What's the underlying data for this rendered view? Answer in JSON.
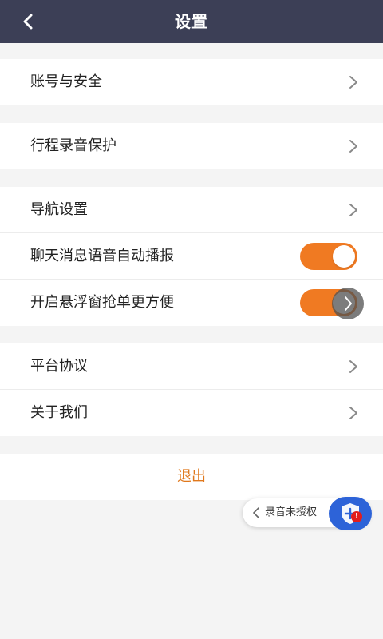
{
  "header": {
    "title": "设置"
  },
  "groups": [
    {
      "items": [
        {
          "label": "账号与安全",
          "control": "chevron"
        }
      ]
    },
    {
      "items": [
        {
          "label": "行程录音保护",
          "control": "chevron"
        }
      ]
    },
    {
      "items": [
        {
          "label": "导航设置",
          "control": "chevron"
        },
        {
          "label": "聊天消息语音自动播报",
          "control": "toggle",
          "on": true
        },
        {
          "label": "开启悬浮窗抢单更方便",
          "control": "toggle",
          "on": true
        }
      ]
    },
    {
      "items": [
        {
          "label": "平台协议",
          "control": "chevron"
        },
        {
          "label": "关于我们",
          "control": "chevron"
        }
      ]
    }
  ],
  "logout_label": "退出",
  "recording_pill": {
    "label": "录音未授权",
    "badge": "!"
  },
  "colors": {
    "header_bg": "#3c3f56",
    "accent_orange": "#f07a22",
    "logout_text": "#e0781c",
    "page_bg": "#f4f4f4",
    "shield_blue": "#2d63d8",
    "alert_red": "#e21d1d"
  }
}
